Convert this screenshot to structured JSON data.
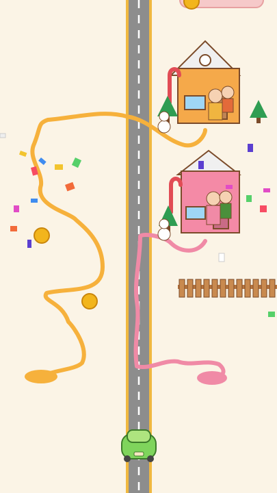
{
  "scene": {
    "background_color": "#fbf4e6",
    "road_color": "#8d8d8d",
    "road_edge_color": "#f0b840",
    "lane_dash_color": "#ffffff"
  },
  "top_hud": {
    "icon": "coin-icon"
  },
  "paths": [
    {
      "name": "yellow-path",
      "color": "#f6b13c",
      "target": "yellow-house"
    },
    {
      "name": "pink-path",
      "color": "#f08aa6",
      "target": "pink-house"
    }
  ],
  "houses": [
    {
      "name": "yellow-house",
      "color": "#f5a94a",
      "roof": "snow",
      "character": "girl-yellow-dress"
    },
    {
      "name": "pink-house",
      "color": "#f48aa6",
      "roof": "snow",
      "character": "girl-pink-dress"
    }
  ],
  "pickups": [
    {
      "name": "gold-coin",
      "icon": "coin-icon"
    },
    {
      "name": "gold-coin",
      "icon": "coin-icon"
    }
  ],
  "vehicle": {
    "name": "green-car",
    "color": "#7fd45c"
  },
  "decor": [
    "candy-cane",
    "christmas-tree",
    "snowman",
    "wooden-fence",
    "confetti"
  ]
}
